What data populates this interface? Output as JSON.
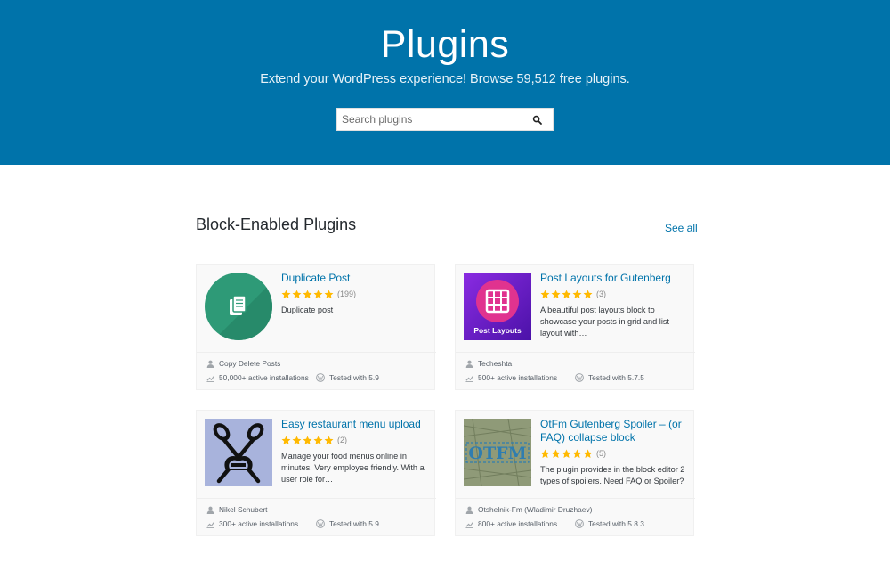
{
  "hero": {
    "title": "Plugins",
    "subtitle": "Extend your WordPress experience! Browse 59,512 free plugins.",
    "search_placeholder": "Search plugins",
    "background_color": "#0073aa"
  },
  "section": {
    "title": "Block-Enabled Plugins",
    "see_all_label": "See all"
  },
  "plugins": [
    {
      "name": "Duplicate Post",
      "rating_stars": 5,
      "rating_count": "(199)",
      "description": "Duplicate post",
      "author": "Copy Delete Posts",
      "installs": "50,000+ active installations",
      "tested": "Tested with 5.9",
      "icon": "document-copy-icon"
    },
    {
      "name": "Post Layouts for Gutenberg",
      "rating_stars": 5,
      "rating_count": "(3)",
      "description": "A beautiful post layouts block to showcase your posts in grid and list layout with…",
      "author": "Techeshta",
      "installs": "500+ active installations",
      "tested": "Tested with 5.7.5",
      "icon": "grid-icon",
      "icon_text": "Post Layouts"
    },
    {
      "name": "Easy restaurant menu upload",
      "rating_stars": 5,
      "rating_count": "(2)",
      "description": "Manage your food menus online in minutes. Very employee friendly. With a user role for…",
      "author": "Nikel Schubert",
      "installs": "300+ active installations",
      "tested": "Tested with 5.9",
      "icon": "crossed-spoon-fork-icon"
    },
    {
      "name": "OtFm Gutenberg Spoiler – (or FAQ) collapse block",
      "rating_stars": 5,
      "rating_count": "(5)",
      "description": "The plugin provides in the block editor 2 types of spoilers. Need FAQ or Spoiler?",
      "author": "Otshelnik-Fm (Wladimir Druzhaev)",
      "installs": "800+ active installations",
      "tested": "Tested with 5.8.3",
      "icon": "otfm-logo-icon",
      "icon_text": "OTFM"
    }
  ],
  "colors": {
    "link": "#0073aa",
    "star": "#ffb900",
    "card_bg": "#f9f9f9"
  }
}
